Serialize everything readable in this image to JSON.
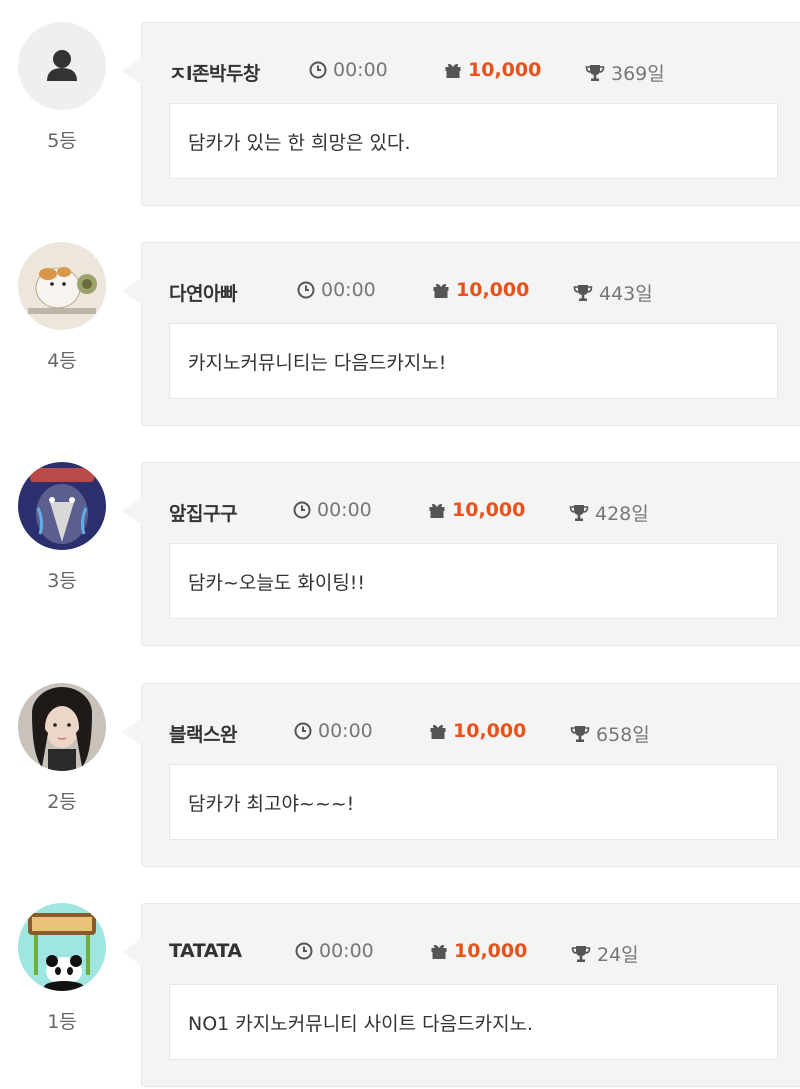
{
  "entries": [
    {
      "rank": "5등",
      "nickname": "ㅈl존박두창",
      "time": "00:00",
      "points": "10,000",
      "days": "369일",
      "message": "담카가 있는 한 희망은 있다.",
      "avatar": "default-user-icon"
    },
    {
      "rank": "4등",
      "nickname": "다연아빠",
      "time": "00:00",
      "points": "10,000",
      "days": "443일",
      "message": "카지노커뮤니티는 다음드카지노!",
      "avatar": "hamster-avatar"
    },
    {
      "rank": "3등",
      "nickname": "앞집구구",
      "time": "00:00",
      "points": "10,000",
      "days": "428일",
      "message": "담카~오늘도 화이팅!!",
      "avatar": "bird-avatar"
    },
    {
      "rank": "2등",
      "nickname": "블랙스완",
      "time": "00:00",
      "points": "10,000",
      "days": "658일",
      "message": "담카가 최고야~~~!",
      "avatar": "woman-photo-avatar"
    },
    {
      "rank": "1등",
      "nickname": "TATATA",
      "time": "00:00",
      "points": "10,000",
      "days": "24일",
      "message": "NO1 카지노커뮤니티 사이트 다음드카지노.",
      "avatar": "tatata-panda-avatar"
    }
  ],
  "colors": {
    "points": "#e8521a",
    "card_bg": "#f4f4f4",
    "text": "#333333",
    "muted": "#777777"
  }
}
